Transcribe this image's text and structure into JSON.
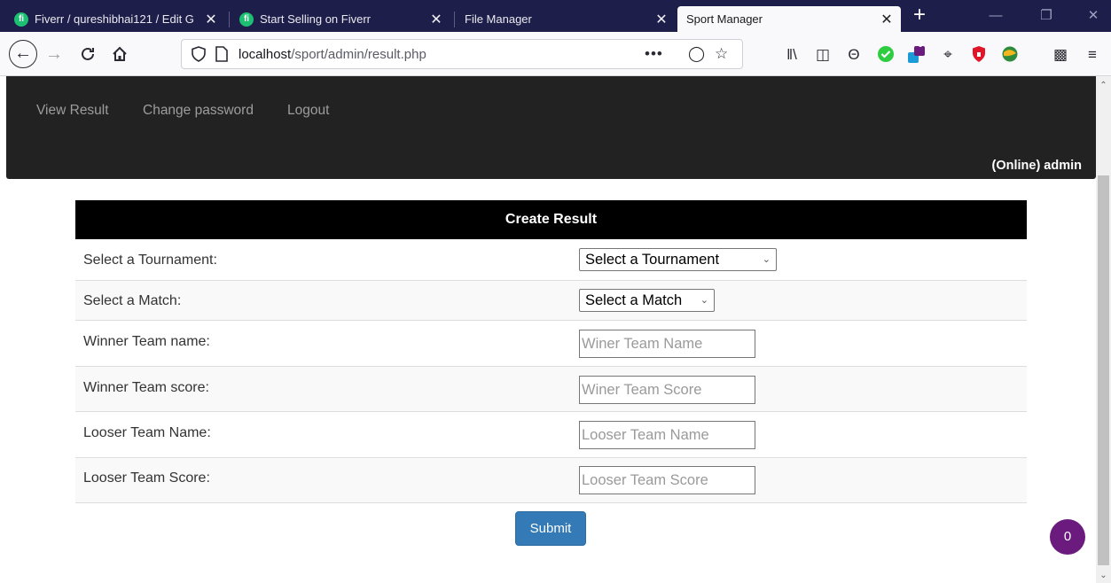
{
  "tabs": [
    {
      "title": "Fiverr / qureshibhai121 / Edit G",
      "close": "✕"
    },
    {
      "title": "Start Selling on Fiverr",
      "close": "✕"
    },
    {
      "title": "File Manager",
      "close": "✕"
    },
    {
      "title": "Sport Manager",
      "close": "✕"
    }
  ],
  "new_tab": "+",
  "favicon_letter": "fi",
  "address": {
    "host": "localhost",
    "path": "/sport/admin/result.php"
  },
  "extension_badge": "0",
  "site_nav": {
    "links": [
      "View Result",
      "Change password",
      "Logout"
    ],
    "status": "(Online) admin"
  },
  "form": {
    "title": "Create Result",
    "rows": [
      {
        "label": "Select a Tournament:",
        "type": "select",
        "value": "Select a Tournament"
      },
      {
        "label": "Select a Match:",
        "type": "select",
        "value": "Select a Match"
      },
      {
        "label": "Winner Team name:",
        "type": "text",
        "placeholder": "Winer Team Name"
      },
      {
        "label": "Winner Team score:",
        "type": "text",
        "placeholder": "Winer Team Score"
      },
      {
        "label": "Looser Team Name:",
        "type": "text",
        "placeholder": "Looser Team Name"
      },
      {
        "label": "Looser Team Score:",
        "type": "text",
        "placeholder": "Looser Team Score"
      }
    ],
    "submit_label": "Submit"
  },
  "chat_count": "0",
  "colors": {
    "tabstrip": "#1e1e4a",
    "site_nav": "#222222",
    "submit": "#337ab7",
    "chat_bubble": "#6b1a7d"
  }
}
